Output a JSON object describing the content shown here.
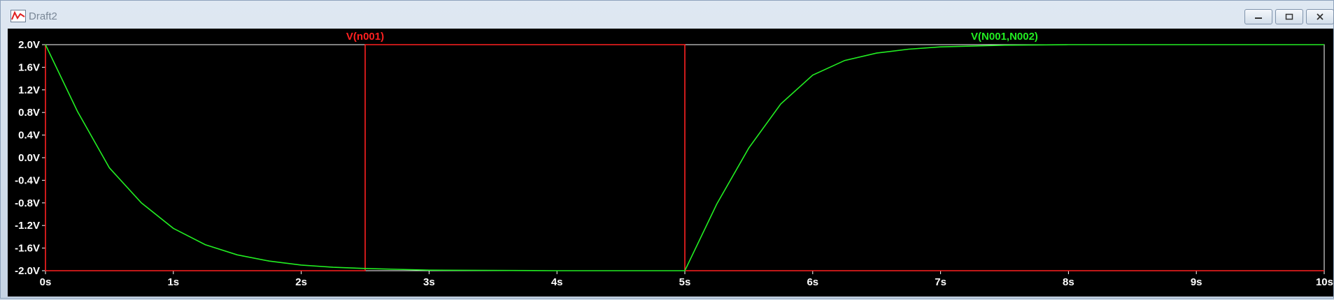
{
  "window": {
    "title": "Draft2",
    "app_icon": "waveform-icon",
    "controls": [
      "minimize-icon",
      "restore-icon",
      "close-icon"
    ]
  },
  "chart_data": {
    "type": "line",
    "xlabel": "",
    "ylabel": "",
    "xlim": [
      0,
      10
    ],
    "ylim": [
      -2.0,
      2.0
    ],
    "x_ticks": [
      "0s",
      "1s",
      "2s",
      "3s",
      "4s",
      "5s",
      "6s",
      "7s",
      "8s",
      "9s",
      "10s"
    ],
    "y_ticks": [
      "2.0V",
      "1.6V",
      "1.2V",
      "0.8V",
      "0.4V",
      "0.0V",
      "-0.4V",
      "-0.8V",
      "-1.2V",
      "-1.6V",
      "-2.0V"
    ],
    "background": "#000000",
    "grid": false,
    "series": [
      {
        "name": "V(n001)",
        "color": "#ff2020",
        "x": [
          0,
          0,
          2.5,
          2.5,
          5,
          5,
          10
        ],
        "y": [
          2.0,
          -2.0,
          -2.0,
          2.0,
          2.0,
          -2.0,
          -2.0
        ]
      },
      {
        "name": "V(N001,N002)",
        "color": "#22ee22",
        "x": [
          0,
          0.25,
          0.5,
          0.75,
          1.0,
          1.25,
          1.5,
          1.75,
          2.0,
          2.25,
          2.5,
          2.75,
          3.0,
          4.0,
          4.99,
          5.0,
          5.25,
          5.5,
          5.75,
          6.0,
          6.25,
          6.5,
          6.75,
          7.0,
          7.5,
          8.0,
          9.0,
          10.0
        ],
        "y": [
          2.0,
          0.82,
          -0.18,
          -0.8,
          -1.25,
          -1.54,
          -1.72,
          -1.83,
          -1.9,
          -1.94,
          -1.96,
          -1.975,
          -1.99,
          -2.0,
          -2.0,
          -2.0,
          -0.82,
          0.17,
          0.95,
          1.46,
          1.72,
          1.85,
          1.92,
          1.96,
          1.99,
          2.0,
          2.0,
          2.0
        ]
      }
    ]
  }
}
